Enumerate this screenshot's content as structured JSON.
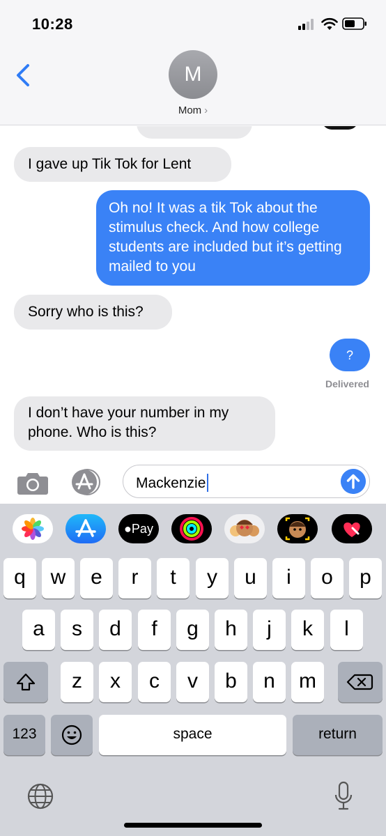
{
  "status_bar": {
    "time": "10:28",
    "signal_icon": "signal-bars-icon",
    "wifi_icon": "wifi-icon",
    "battery_icon": "battery-icon"
  },
  "header": {
    "avatar_initial": "M",
    "contact_name": "Mom",
    "contact_chevron": "›",
    "back_icon": "chevron-left-icon"
  },
  "messages": [
    {
      "direction": "incoming",
      "text": "I gave up Tik Tok for Lent"
    },
    {
      "direction": "outgoing",
      "text": "Oh no! It was a tik Tok about the stimulus check. And how college students are included but it’s getting mailed to you"
    },
    {
      "direction": "incoming",
      "text": "Sorry who is this?"
    },
    {
      "direction": "outgoing",
      "text": "?"
    },
    {
      "direction": "incoming",
      "text": "I don’t have your number in my phone. Who is this?"
    }
  ],
  "delivery_status": "Delivered",
  "composer": {
    "value": "Mackenzie",
    "camera_icon": "camera-icon",
    "apps_icon": "app-store-icon",
    "send_icon": "send-arrow-icon"
  },
  "app_strip": [
    {
      "name": "Photos",
      "icon": "photos-icon"
    },
    {
      "name": "App Store",
      "icon": "app-store-icon"
    },
    {
      "name": "Apple Pay",
      "label": "Pay",
      "icon": "apple-pay-icon"
    },
    {
      "name": "Activity",
      "icon": "activity-rings-icon"
    },
    {
      "name": "Memoji Stickers",
      "icon": "memoji-stickers-icon"
    },
    {
      "name": "Animoji",
      "icon": "animoji-icon"
    },
    {
      "name": "Digital Touch",
      "icon": "digital-touch-heart-icon"
    }
  ],
  "keyboard": {
    "row1": [
      "q",
      "w",
      "e",
      "r",
      "t",
      "y",
      "u",
      "i",
      "o",
      "p"
    ],
    "row2": [
      "a",
      "s",
      "d",
      "f",
      "g",
      "h",
      "j",
      "k",
      "l"
    ],
    "row3": [
      "z",
      "x",
      "c",
      "v",
      "b",
      "n",
      "m"
    ],
    "shift_icon": "shift-icon",
    "delete_icon": "delete-backspace-icon",
    "numbers_label": "123",
    "emoji_icon": "emoji-icon",
    "space_label": "space",
    "return_label": "return",
    "globe_icon": "globe-icon",
    "mic_icon": "microphone-icon"
  },
  "colors": {
    "outgoing_bubble": "#3a82f6",
    "incoming_bubble": "#e9e9eb",
    "accent": "#2f7cf6",
    "keyboard_bg": "#d3d5db"
  }
}
